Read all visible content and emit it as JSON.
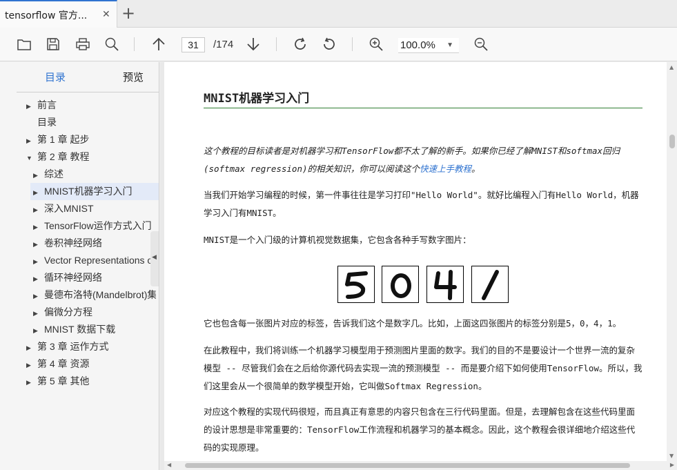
{
  "tab": {
    "title": "tensorflow 官方...",
    "close_glyph": "✕",
    "new_tab_glyph": "+"
  },
  "toolbar": {
    "icons": [
      "open-folder-icon",
      "save-icon",
      "print-icon",
      "search-icon",
      "arrow-up-icon",
      "arrow-down-icon",
      "rotate-clockwise-icon",
      "rotate-counterclockwise-icon",
      "zoom-in-icon",
      "zoom-out-icon"
    ],
    "page_current": "31",
    "page_total": "/174",
    "zoom": "100.0%"
  },
  "sidebar": {
    "tabs": [
      {
        "label": "目录",
        "active": true
      },
      {
        "label": "预览",
        "active": false
      }
    ],
    "items": [
      {
        "label": "前言",
        "arrow": "▶"
      },
      {
        "label": "目录",
        "arrow": ""
      },
      {
        "label": "第 1 章 起步",
        "arrow": "▶"
      },
      {
        "label": "第 2 章 教程",
        "arrow": "▼"
      },
      {
        "label": "综述",
        "arrow": "▶"
      },
      {
        "label": "MNIST机器学习入门",
        "arrow": "▶"
      },
      {
        "label": "深入MNIST",
        "arrow": "▶"
      },
      {
        "label": "TensorFlow运作方式入门",
        "arrow": "▶"
      },
      {
        "label": "卷积神经网络",
        "arrow": "▶"
      },
      {
        "label": "Vector Representations of Words",
        "arrow": "▶"
      },
      {
        "label": "循环神经网络",
        "arrow": "▶"
      },
      {
        "label": "曼德布洛特(Mandelbrot)集合",
        "arrow": "▶"
      },
      {
        "label": "偏微分方程",
        "arrow": "▶"
      },
      {
        "label": "MNIST 数据下载",
        "arrow": "▶"
      },
      {
        "label": "第 3 章 运作方式",
        "arrow": "▶"
      },
      {
        "label": "第 4 章 资源",
        "arrow": "▶"
      },
      {
        "label": "第 5 章 其他",
        "arrow": "▶"
      }
    ],
    "collapse_glyph": "◀"
  },
  "document": {
    "title": "MNIST机器学习入门",
    "intro_part1": "这个教程的目标读者是对机器学习和TensorFlow都不太了解的新手。如果你已经了解MNIST和softmax回归(softmax regression)的相关知识，你可以阅读这个",
    "intro_link": "快速上手教程",
    "intro_part2": "。",
    "p1": "当我们开始学习编程的时候，第一件事往往是学习打印\"Hello World\"。就好比编程入门有Hello World，机器学习入门有MNIST。",
    "p2": "MNIST是一个入门级的计算机视觉数据集，它包含各种手写数字图片：",
    "digits": [
      "5",
      "0",
      "4",
      "1"
    ],
    "p3": "它也包含每一张图片对应的标签，告诉我们这个是数字几。比如，上面这四张图片的标签分别是5，0，4，1。",
    "p4": "在此教程中，我们将训练一个机器学习模型用于预测图片里面的数字。我们的目的不是要设计一个世界一流的复杂模型 -- 尽管我们会在之后给你源代码去实现一流的预测模型 -- 而是要介绍下如何使用TensorFlow。所以，我们这里会从一个很简单的数学模型开始，它叫做Softmax Regression。",
    "p5": "对应这个教程的实现代码很短，而且真正有意思的内容只包含在三行代码里面。但是，去理解包含在这些代码里面的设计思想是非常重要的：TensorFlow工作流程和机器学习的基本概念。因此，这个教程会很详细地介绍这些代码的实现原理。"
  },
  "colors": {
    "accent": "#2f73d0",
    "title_rule": "#2e7d32",
    "selected_bg": "#e3eaf8"
  }
}
